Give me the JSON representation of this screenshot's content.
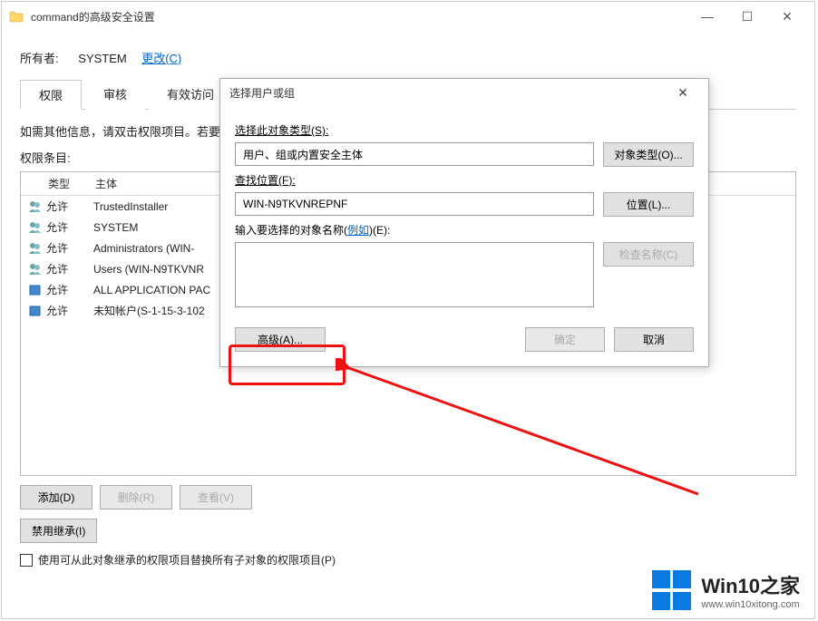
{
  "main_window": {
    "title": "command的高级安全设置",
    "owner_label": "所有者:",
    "owner_value": "SYSTEM",
    "change_link": "更改(C)",
    "tabs": [
      "权限",
      "审核",
      "有效访问"
    ],
    "instruction": "如需其他信息，请双击权限项目。若要",
    "perm_label": "权限条目:",
    "cols": {
      "c1": "类型",
      "c2": "主体"
    },
    "rows": [
      {
        "type": "允许",
        "principal": "TrustedInstaller"
      },
      {
        "type": "允许",
        "principal": "SYSTEM"
      },
      {
        "type": "允许",
        "principal": "Administrators (WIN-"
      },
      {
        "type": "允许",
        "principal": "Users (WIN-N9TKVNR"
      },
      {
        "type": "允许",
        "principal": "ALL APPLICATION PAC"
      },
      {
        "type": "允许",
        "principal": "未知帐户(S-1-15-3-102"
      }
    ],
    "buttons": {
      "add": "添加(D)",
      "remove": "删除(R)",
      "view": "查看(V)"
    },
    "inherit_btn": "禁用继承(I)",
    "checkbox_label": "使用可从此对象继承的权限项目替换所有子对象的权限项目(P)"
  },
  "dialog": {
    "title": "选择用户或组",
    "f1_label": "选择此对象类型(S):",
    "f1_value": "用户、组或内置安全主体",
    "f1_btn": "对象类型(O)...",
    "f2_label": "查找位置(F):",
    "f2_value": "WIN-N9TKVNREPNF",
    "f2_btn": "位置(L)...",
    "f3_label_a": "输入要选择的对象名称(",
    "f3_label_link": "例如",
    "f3_label_b": ")(E):",
    "f3_value": "",
    "f3_btn": "检查名称(C)",
    "advanced_btn": "高级(A)...",
    "ok_btn": "确定",
    "cancel_btn": "取消"
  },
  "watermark": {
    "brand": "Win10之家",
    "url": "www.win10xitong.com"
  }
}
